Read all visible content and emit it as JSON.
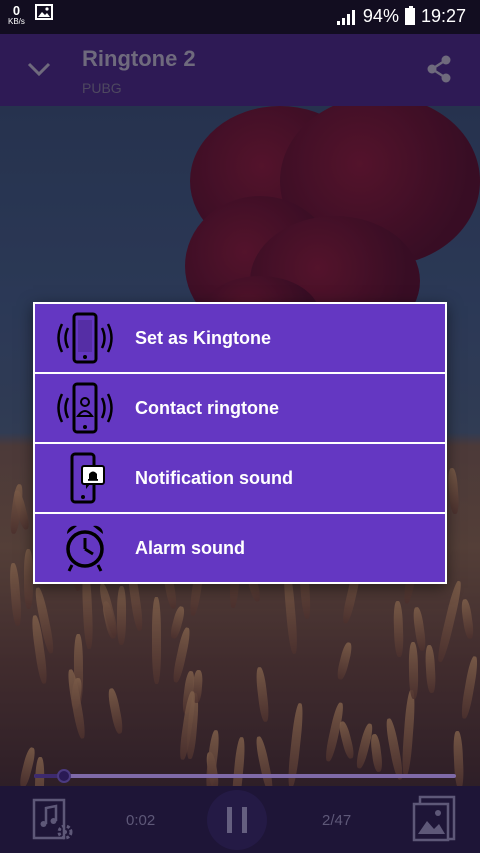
{
  "status_bar": {
    "kbs_value": "0",
    "kbs_unit": "KB/s",
    "battery": "94%",
    "time": "19:27"
  },
  "header": {
    "title": "Ringtone 2",
    "subtitle": "PUBG"
  },
  "dialog": {
    "options": [
      {
        "label": "Set as Kingtone",
        "icon": "ringing-phone-icon"
      },
      {
        "label": "Contact ringtone",
        "icon": "contact-phone-icon"
      },
      {
        "label": "Notification sound",
        "icon": "notification-phone-icon"
      },
      {
        "label": "Alarm sound",
        "icon": "alarm-clock-icon"
      }
    ]
  },
  "player": {
    "elapsed": "0:02",
    "track_position": "2/47",
    "progress": 0.07
  },
  "colors": {
    "dialog_option": "#6437c2",
    "header": "#2e1a55",
    "player_bar": "#1e1537"
  }
}
